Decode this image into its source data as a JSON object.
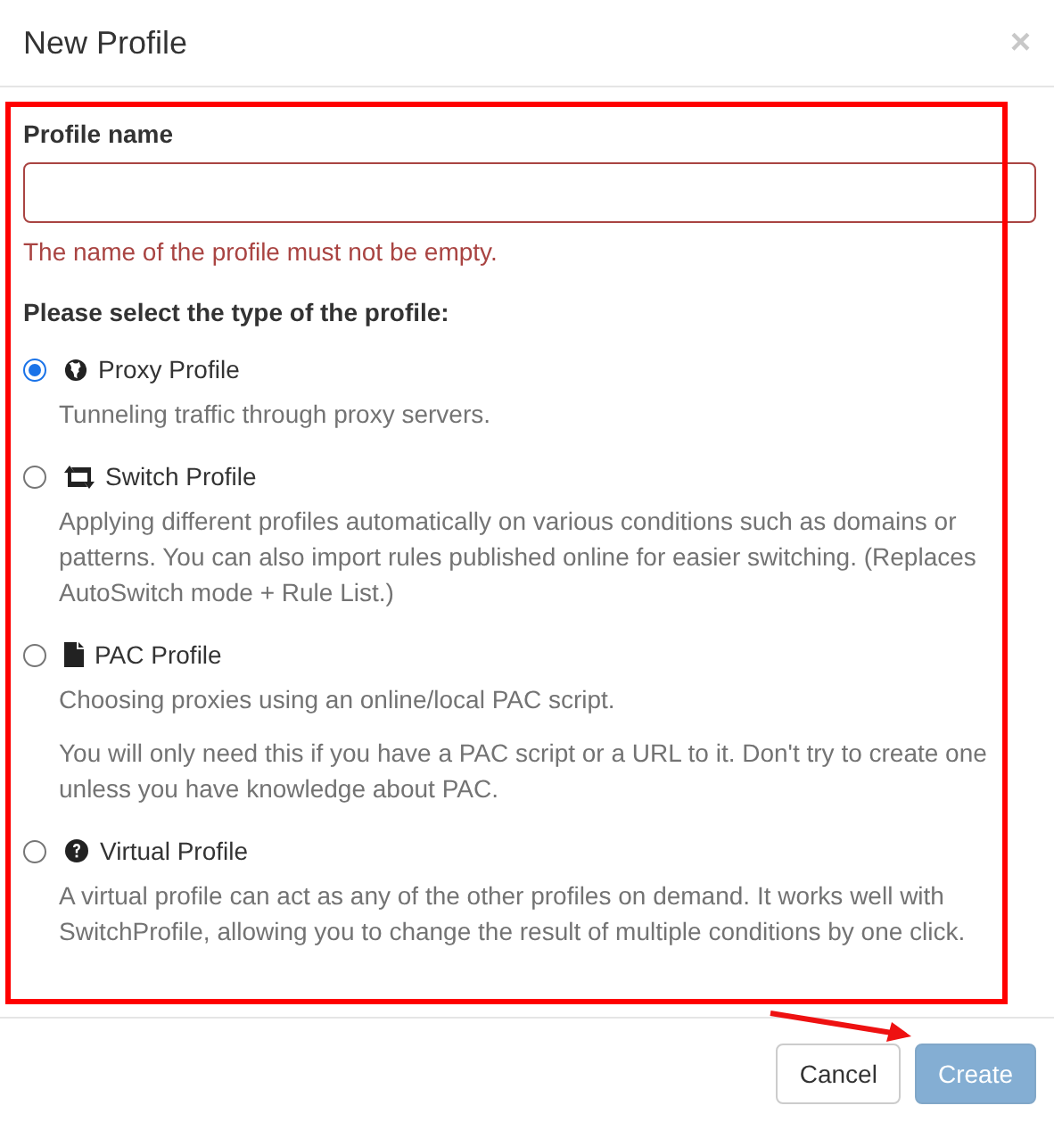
{
  "dialog": {
    "title": "New Profile",
    "close": "×"
  },
  "name_field": {
    "label": "Profile name",
    "error": "The name of the profile must not be empty.",
    "invalid": true
  },
  "type_prompt": "Please select the type of the profile:",
  "profile_types": [
    {
      "kind": "globe",
      "label": "Proxy Profile",
      "selected": true,
      "descriptions": [
        "Tunneling traffic through proxy servers."
      ]
    },
    {
      "kind": "switch",
      "label": "Switch Profile",
      "selected": false,
      "descriptions": [
        "Applying different profiles automatically on various conditions such as domains or patterns. You can also import rules published online for easier switching. (Replaces AutoSwitch mode + Rule List.)"
      ]
    },
    {
      "kind": "file",
      "label": "PAC Profile",
      "selected": false,
      "descriptions": [
        "Choosing proxies using an online/local PAC script.",
        "You will only need this if you have a PAC script or a URL to it. Don't try to create one unless you have knowledge about PAC."
      ]
    },
    {
      "kind": "question",
      "label": "Virtual Profile",
      "selected": false,
      "descriptions": [
        "A virtual profile can act as any of the other profiles on demand. It works well with SwitchProfile, allowing you to change the result of multiple conditions by one click."
      ]
    }
  ],
  "buttons": [
    {
      "label": "Cancel",
      "kind": "default",
      "disabled": false
    },
    {
      "label": "Create",
      "kind": "primary",
      "disabled": true
    }
  ]
}
